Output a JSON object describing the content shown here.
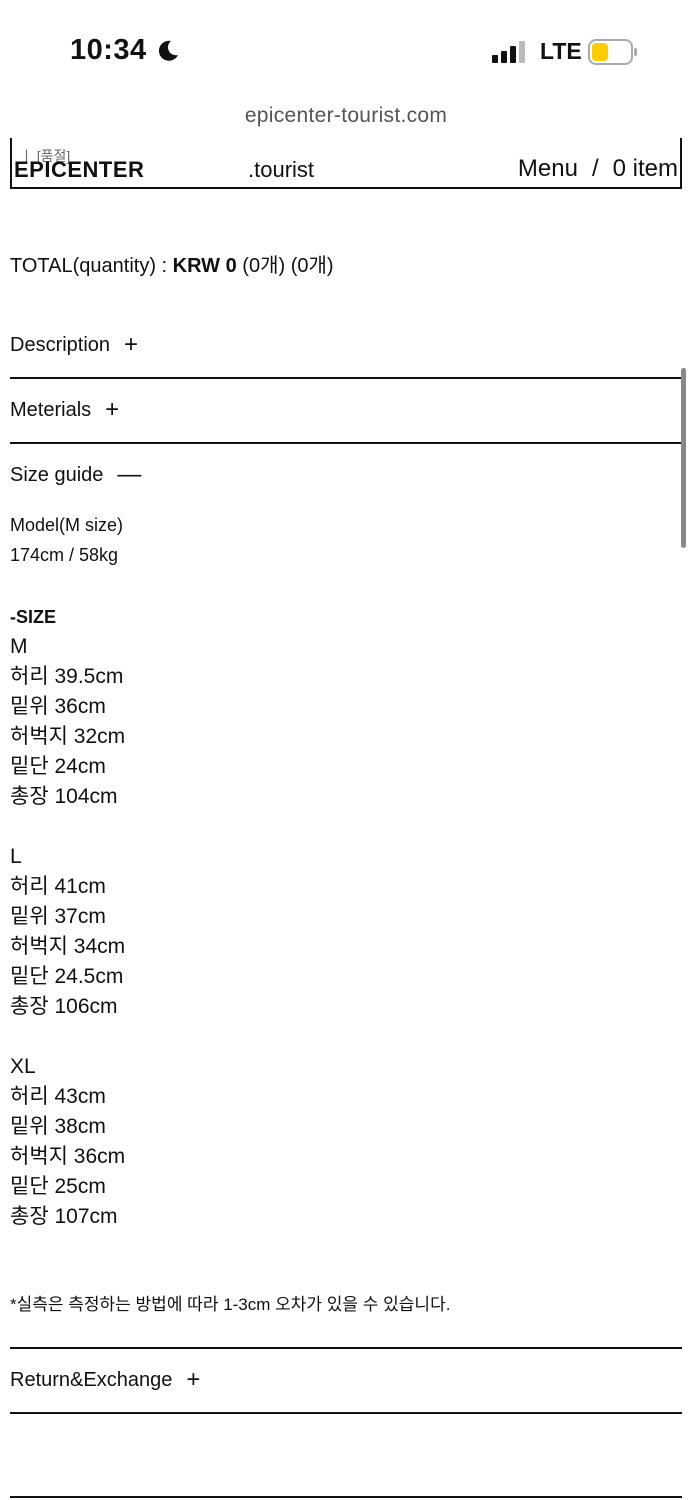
{
  "status_bar": {
    "time": "10:34",
    "moon_icon": "moon-icon",
    "signal_icon": "cellular-signal-icon",
    "network": "LTE",
    "battery_icon": "battery-icon",
    "battery_color": "#ffcc00"
  },
  "address_bar": {
    "url": "epicenter-tourist.com"
  },
  "header": {
    "overlay_text": "ㅣ [품절]",
    "brand": "EPICENTER",
    "brand_suffix": ".tourist",
    "menu": "Menu",
    "separator": "/",
    "cart": "0 item"
  },
  "total": {
    "label": "TOTAL(quantity) : ",
    "amount": "KRW 0",
    "qty1": " (0개)",
    "qty2": " (0개)"
  },
  "sections": {
    "description": {
      "label": "Description",
      "sign": "+"
    },
    "materials": {
      "label": "Meterials",
      "sign": "+"
    },
    "size_guide": {
      "label": "Size guide",
      "sign": "—"
    },
    "return_exchange": {
      "label": "Return&Exchange",
      "sign": "+"
    }
  },
  "size_guide": {
    "model_line1": "Model(M size)",
    "model_line2": "174cm / 58kg",
    "heading": "-SIZE",
    "sizes": [
      {
        "label": "M",
        "rows": [
          "허리 39.5cm",
          "밑위 36cm",
          "허벅지 32cm",
          "밑단 24cm",
          "총장 104cm"
        ]
      },
      {
        "label": "L",
        "rows": [
          "허리 41cm",
          "밑위 37cm",
          "허벅지 34cm",
          "밑단 24.5cm",
          "총장 106cm"
        ]
      },
      {
        "label": "XL",
        "rows": [
          "허리 43cm",
          "밑위 38cm",
          "허벅지 36cm",
          "밑단 25cm",
          "총장 107cm"
        ]
      }
    ],
    "note": "*실측은 측정하는 방법에 따라 1-3cm 오차가 있을 수 있습니다."
  }
}
